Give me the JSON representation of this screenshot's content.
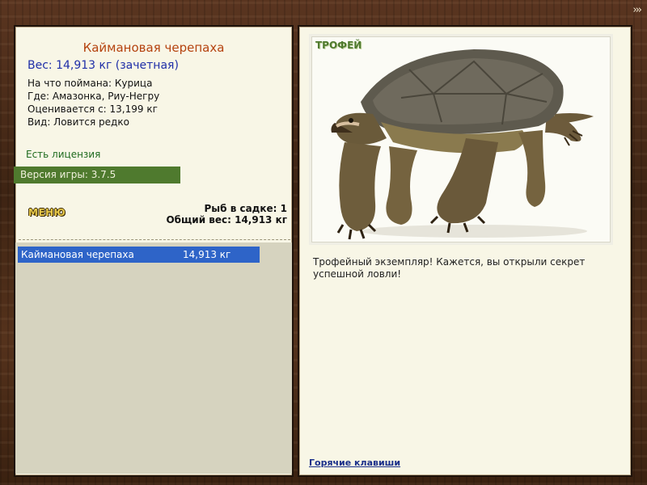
{
  "header": {
    "corner_arrows": "›››"
  },
  "fish": {
    "name": "Каймановая черепаха",
    "weight": "Вес: 14,913 кг (зачетная)",
    "bait": "На что поймана: Курица",
    "location": "Где: Амазонка, Риу-Негру",
    "threshold": "Оценивается с: 13,199 кг",
    "rarity": "Вид: Ловится редко"
  },
  "license": "Есть лицензия",
  "version": "Версия игры: 3.7.5",
  "menu_label": "МЕНЮ",
  "keepnet": {
    "count": "Рыб в садке: 1",
    "total": "Общий вес: 14,913 кг"
  },
  "catch_list": [
    {
      "name": "Каймановая черепаха",
      "weight": "14,913 кг"
    }
  ],
  "trophy": {
    "label": "ТРОФЕЙ",
    "image": "snapping-turtle",
    "message": "Трофейный экземпляр! Кажется, вы открыли секрет успешной ловли!"
  },
  "hotkeys": "Горячие клавиши",
  "colors": {
    "panel_bg": "#f8f6e6",
    "title": "#b5430f",
    "weight": "#1f2fa8",
    "license": "#1f6b1f",
    "version_bar": "#4f7a2e",
    "selection": "#2e64c8",
    "link": "#1a2f8a"
  }
}
